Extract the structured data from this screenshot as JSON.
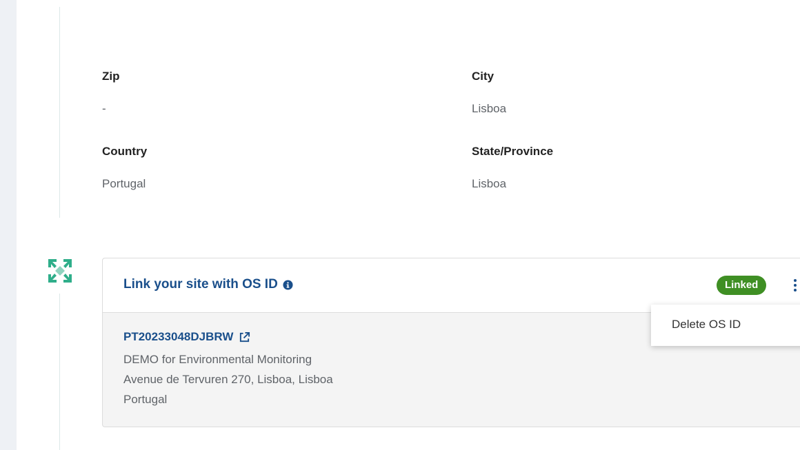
{
  "address": {
    "zip": {
      "label": "Zip",
      "value": "-"
    },
    "city": {
      "label": "City",
      "value": "Lisboa"
    },
    "country": {
      "label": "Country",
      "value": "Portugal"
    },
    "state": {
      "label": "State/Province",
      "value": "Lisboa"
    }
  },
  "os_card": {
    "title": "Link your site with OS ID",
    "status_badge": "Linked",
    "os_id": "PT20233048DJBRW",
    "facility_name": "DEMO for Environmental Monitoring",
    "facility_address": "Avenue de Tervuren 270, Lisboa, Lisboa",
    "facility_country": "Portugal",
    "accent_color": "#1a4f8b",
    "badge_color": "#3f8f24"
  },
  "menu": {
    "items": [
      "Delete OS ID"
    ]
  },
  "icons": {
    "timeline": "os-hub-icon",
    "info": "info-circle-icon",
    "external": "external-link-icon",
    "menu": "kebab-menu-icon"
  }
}
